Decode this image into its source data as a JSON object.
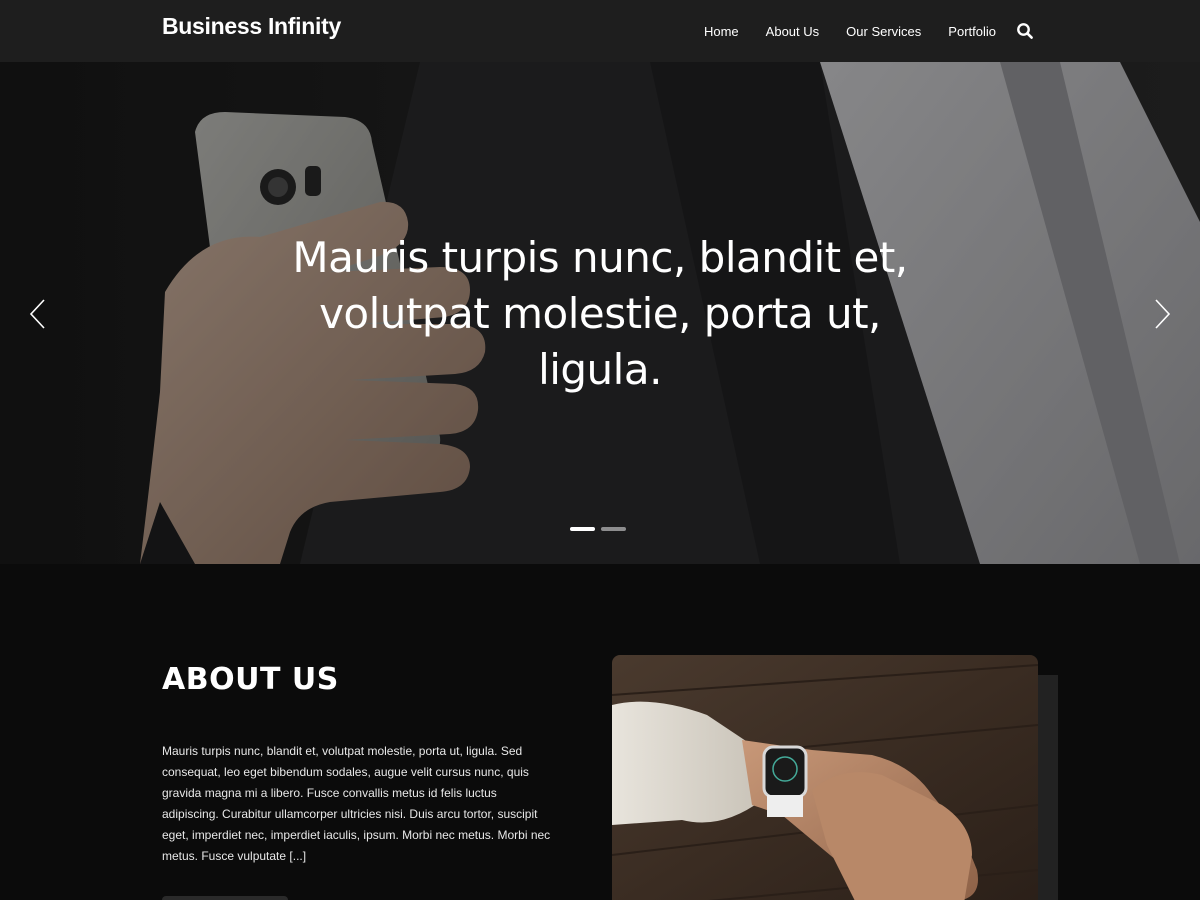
{
  "site": {
    "brand": "Business Infinity"
  },
  "nav": {
    "items": [
      {
        "label": "Home"
      },
      {
        "label": "About Us"
      },
      {
        "label": "Our Services"
      },
      {
        "label": "Portfolio"
      }
    ],
    "search_icon": "search-icon"
  },
  "hero": {
    "heading": "Mauris turpis nunc, blandit et, volutpat molestie, porta ut, ligula.",
    "prev_icon": "chevron-left-icon",
    "next_icon": "chevron-right-icon",
    "slides_count": 2,
    "active_slide": 1
  },
  "about": {
    "title": "ABOUT US",
    "text": "Mauris turpis nunc, blandit et, volutpat molestie, porta ut, ligula. Sed consequat, leo eget bibendum sodales, augue velit cursus nunc, quis gravida magna mi a libero. Fusce convallis metus id felis luctus adipiscing. Curabitur ullamcorper ultricies nisi. Duis arcu tortor, suscipit eget, imperdiet nec, imperdiet iaculis, ipsum. Morbi nec metus. Morbi nec metus. Fusce vulputate [...]"
  },
  "colors": {
    "header_bg": "#1e1e1e",
    "page_bg": "#0b0b0b",
    "text": "#ffffff"
  }
}
